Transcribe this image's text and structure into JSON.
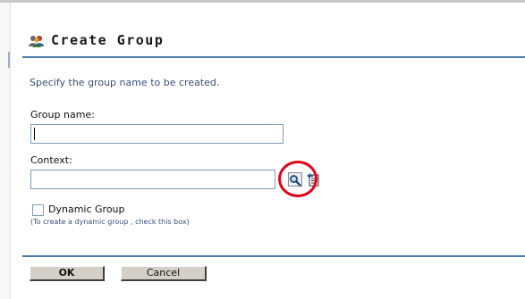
{
  "header": {
    "title": "Create Group",
    "icon": "group-icon"
  },
  "instructions": "Specify the group name to be created.",
  "form": {
    "group_name": {
      "label": "Group name:",
      "value": ""
    },
    "context": {
      "label": "Context:",
      "value": "",
      "search_icon": "magnifier-icon",
      "browse_icon": "object-browser-icon"
    },
    "dynamic_group": {
      "label": "Dynamic Group",
      "checked": false,
      "hint": "(To create a dynamic group , check this box)"
    }
  },
  "buttons": {
    "ok_label": "OK",
    "cancel_label": "Cancel"
  },
  "colors": {
    "rule": "#4f7cae",
    "highlight": "#e2001a",
    "hint_text": "#3a4f7a"
  }
}
